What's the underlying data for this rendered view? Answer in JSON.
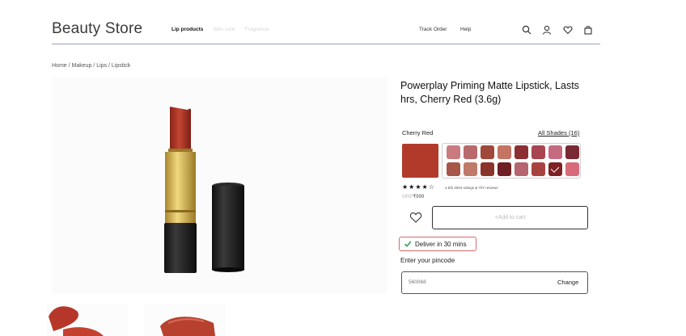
{
  "header": {
    "logo": "Beauty Store",
    "nav": [
      "Lip products",
      "Skin care",
      "Fragrance"
    ],
    "track_order": "Track Order",
    "help": "Help",
    "icons": [
      "search-icon",
      "user-icon",
      "heart-icon",
      "bag-icon"
    ]
  },
  "breadcrumb": "Home / Makeup / Lips / Lipstick",
  "product": {
    "title": "Powerplay Priming Matte Lipstick, Lasts hrs, Cherry Red (3.6g)",
    "shade_name": "Cherry Red",
    "all_shades": "All Shades (16)",
    "selected_color": "#b23a2b",
    "swatches": [
      "#c97b80",
      "#b8696b",
      "#a0493b",
      "#c47463",
      "#8c2f33",
      "#a84550",
      "#c66a80",
      "#7a2a33",
      "#a8564a",
      "#c07a6a",
      "#8a3328",
      "#6e1e24",
      "#b56470",
      "#a84240",
      "#7e2024",
      "#d86b7a"
    ],
    "selected_swatch": 14,
    "rating_stars": "★★★★☆",
    "rating_text": "4.5/5 4004 ratings & 707 reviews",
    "mrp": "MRP",
    "price": "₹999",
    "add_to_cart": "+Add to cart",
    "deliver": "Deliver in 30 mins",
    "pincode_label": "Enter your pincode",
    "pincode_value": "560068",
    "change": "Change"
  },
  "colors": {
    "accent": "#b23a2b",
    "gold": "#d7b54c",
    "cap": "#1c1c1c"
  }
}
